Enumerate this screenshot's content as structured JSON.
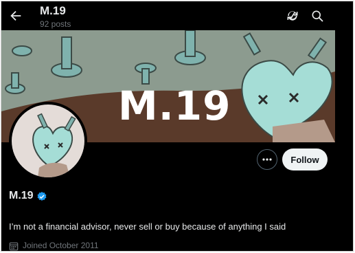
{
  "header": {
    "title": "M.19",
    "post_count": "92 posts"
  },
  "banner": {
    "text": "M.19"
  },
  "actions": {
    "follow_label": "Follow"
  },
  "profile": {
    "name": "M.19",
    "bio": "I’m not a financial advisor, never sell or buy because of anything I said",
    "joined": "Joined October 2011",
    "verified_color": "#1d9bf0"
  },
  "icons": [
    "back-arrow-icon",
    "refresh-icon",
    "search-icon",
    "more-icon",
    "verified-badge-icon",
    "calendar-icon"
  ]
}
